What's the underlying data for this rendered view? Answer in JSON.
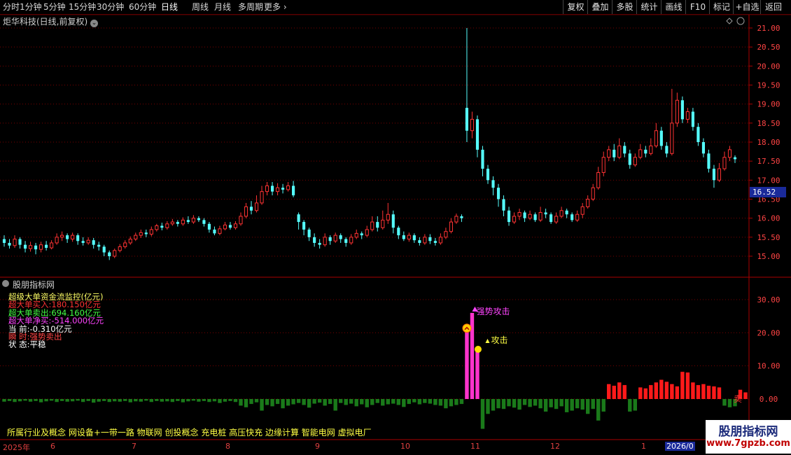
{
  "toolbar": {
    "periods": [
      "分时",
      "1分钟",
      "5分钟",
      "15分钟",
      "30分钟",
      "60分钟",
      "日线",
      "周线",
      "月线",
      "多周期",
      "更多"
    ],
    "active_period": "日线",
    "right_buttons": [
      "复权",
      "叠加",
      "多股",
      "统计",
      "画线",
      "F10",
      "标记",
      "+自选",
      "返回"
    ]
  },
  "stock_title": "炬华科技(日线,前复权)",
  "price_axis": {
    "labels": [
      "21.00",
      "20.50",
      "20.00",
      "19.50",
      "19.00",
      "18.50",
      "18.00",
      "17.50",
      "17.00",
      "16.50",
      "16.00",
      "15.50",
      "15.00"
    ],
    "current_price": "16.52"
  },
  "indicator": {
    "panel_title": "股朋指标网",
    "lines": [
      {
        "text": "超级大单资金流监控(亿元)",
        "color": "#ffff66"
      },
      {
        "text": "超大单买入:180.150亿元",
        "color": "#ff3333"
      },
      {
        "text": "超大单卖出:694.160亿元",
        "color": "#44ff44"
      },
      {
        "text": "超大单净买:-514.000亿元",
        "color": "#ff44ff"
      },
      {
        "text": "当      前:-0.310亿元",
        "color": "#ffffff"
      },
      {
        "text": "瞬      时:强势卖出",
        "color": "#ff4444"
      },
      {
        "text": "状      态:平稳",
        "color": "#ffffff"
      }
    ],
    "axis_labels": [
      "30.00",
      "20.00",
      "10.00",
      "0.00"
    ],
    "annotation_strong": "强势攻击",
    "annotation_attack": "攻击",
    "annotation_end": "卖"
  },
  "concepts": "所属行业及概念  网设备+一带一路 物联网 创投概念 充电桩 高压快充 边缘计算 智能电网 虚拟电厂",
  "date_axis": [
    "2025年",
    "6",
    "7",
    "8",
    "9",
    "10",
    "11",
    "12",
    "1",
    "2026/0"
  ],
  "watermark": {
    "line1": "股朋指标网",
    "line2": "www.7gpzb.com"
  },
  "colors": {
    "up": "#ff3333",
    "down": "#55ffff",
    "grid": "#7a0000",
    "inflow": "#ff1a1a",
    "outflow": "#1a7a1a",
    "signal": "#ff33cc"
  },
  "chart_data": {
    "type": "candlestick",
    "ylim": [
      14.7,
      21.2
    ],
    "candles": [
      [
        15.45,
        15.35,
        15.55,
        15.25
      ],
      [
        15.35,
        15.28,
        15.45,
        15.2
      ],
      [
        15.28,
        15.45,
        15.55,
        15.22
      ],
      [
        15.45,
        15.3,
        15.5,
        15.2
      ],
      [
        15.3,
        15.2,
        15.4,
        15.1
      ],
      [
        15.2,
        15.28,
        15.38,
        15.12
      ],
      [
        15.28,
        15.18,
        15.35,
        15.05
      ],
      [
        15.18,
        15.3,
        15.38,
        15.1
      ],
      [
        15.3,
        15.22,
        15.4,
        15.15
      ],
      [
        15.22,
        15.35,
        15.42,
        15.18
      ],
      [
        15.35,
        15.5,
        15.6,
        15.3
      ],
      [
        15.5,
        15.55,
        15.65,
        15.4
      ],
      [
        15.55,
        15.45,
        15.6,
        15.35
      ],
      [
        15.45,
        15.55,
        15.62,
        15.38
      ],
      [
        15.55,
        15.4,
        15.6,
        15.3
      ],
      [
        15.4,
        15.35,
        15.5,
        15.28
      ],
      [
        15.35,
        15.42,
        15.5,
        15.3
      ],
      [
        15.42,
        15.3,
        15.48,
        15.2
      ],
      [
        15.3,
        15.25,
        15.38,
        15.15
      ],
      [
        15.25,
        15.1,
        15.3,
        15.0
      ],
      [
        15.1,
        15.0,
        15.15,
        14.9
      ],
      [
        15.0,
        15.15,
        15.2,
        14.95
      ],
      [
        15.15,
        15.25,
        15.32,
        15.1
      ],
      [
        15.25,
        15.35,
        15.42,
        15.2
      ],
      [
        15.35,
        15.45,
        15.52,
        15.3
      ],
      [
        15.45,
        15.55,
        15.62,
        15.4
      ],
      [
        15.55,
        15.62,
        15.7,
        15.48
      ],
      [
        15.62,
        15.58,
        15.7,
        15.5
      ],
      [
        15.58,
        15.7,
        15.78,
        15.52
      ],
      [
        15.7,
        15.8,
        15.85,
        15.65
      ],
      [
        15.8,
        15.75,
        15.88,
        15.68
      ],
      [
        15.75,
        15.85,
        15.92,
        15.7
      ],
      [
        15.85,
        15.9,
        15.98,
        15.8
      ],
      [
        15.9,
        15.85,
        15.95,
        15.78
      ],
      [
        15.85,
        15.95,
        16.02,
        15.8
      ],
      [
        15.95,
        15.9,
        16.05,
        15.85
      ],
      [
        15.9,
        16.0,
        16.08,
        15.85
      ],
      [
        16.0,
        15.95,
        16.05,
        15.9
      ],
      [
        15.95,
        15.85,
        16.0,
        15.78
      ],
      [
        15.85,
        15.7,
        15.9,
        15.62
      ],
      [
        15.7,
        15.6,
        15.78,
        15.55
      ],
      [
        15.6,
        15.72,
        15.8,
        15.55
      ],
      [
        15.72,
        15.82,
        15.9,
        15.68
      ],
      [
        15.82,
        15.75,
        15.9,
        15.7
      ],
      [
        15.75,
        15.85,
        15.92,
        15.7
      ],
      [
        15.85,
        16.05,
        16.15,
        15.8
      ],
      [
        16.05,
        16.3,
        16.4,
        16.0
      ],
      [
        16.3,
        16.2,
        16.45,
        16.1
      ],
      [
        16.2,
        16.4,
        16.6,
        16.15
      ],
      [
        16.4,
        16.7,
        16.85,
        16.35
      ],
      [
        16.7,
        16.85,
        16.95,
        16.6
      ],
      [
        16.85,
        16.7,
        16.95,
        16.6
      ],
      [
        16.7,
        16.8,
        16.92,
        16.6
      ],
      [
        16.8,
        16.75,
        16.9,
        16.65
      ],
      [
        16.75,
        16.85,
        16.95,
        16.7
      ],
      [
        16.85,
        16.6,
        16.98,
        16.55
      ],
      [
        16.1,
        15.9,
        16.15,
        15.7
      ],
      [
        15.9,
        15.7,
        15.95,
        15.55
      ],
      [
        15.7,
        15.5,
        15.75,
        15.4
      ],
      [
        15.5,
        15.35,
        15.6,
        15.25
      ],
      [
        15.35,
        15.3,
        15.45,
        15.2
      ],
      [
        15.3,
        15.5,
        15.6,
        15.25
      ],
      [
        15.5,
        15.4,
        15.55,
        15.3
      ],
      [
        15.4,
        15.55,
        15.62,
        15.35
      ],
      [
        15.55,
        15.45,
        15.6,
        15.35
      ],
      [
        15.45,
        15.35,
        15.5,
        15.25
      ],
      [
        15.35,
        15.5,
        15.58,
        15.3
      ],
      [
        15.5,
        15.6,
        15.7,
        15.45
      ],
      [
        15.6,
        15.55,
        15.65,
        15.45
      ],
      [
        15.55,
        15.7,
        15.8,
        15.5
      ],
      [
        15.7,
        15.9,
        16.05,
        15.65
      ],
      [
        15.9,
        15.75,
        16.05,
        15.65
      ],
      [
        15.75,
        15.95,
        16.2,
        15.7
      ],
      [
        15.95,
        16.1,
        16.4,
        15.85
      ],
      [
        16.1,
        15.75,
        16.2,
        15.6
      ],
      [
        15.75,
        15.55,
        15.8,
        15.45
      ],
      [
        15.55,
        15.45,
        15.65,
        15.4
      ],
      [
        15.45,
        15.55,
        15.62,
        15.38
      ],
      [
        15.55,
        15.42,
        15.6,
        15.35
      ],
      [
        15.42,
        15.35,
        15.5,
        15.28
      ],
      [
        15.35,
        15.5,
        15.58,
        15.3
      ],
      [
        15.5,
        15.4,
        15.58,
        15.32
      ],
      [
        15.4,
        15.35,
        15.48,
        15.28
      ],
      [
        15.35,
        15.5,
        15.6,
        15.3
      ],
      [
        15.5,
        15.65,
        15.75,
        15.45
      ],
      [
        15.65,
        15.9,
        16.0,
        15.6
      ],
      [
        15.9,
        16.05,
        16.12,
        15.85
      ],
      [
        16.05,
        16.0,
        16.1,
        15.9
      ],
      [
        18.9,
        18.3,
        21.0,
        18.0
      ],
      [
        18.3,
        18.6,
        18.8,
        18.1
      ],
      [
        18.6,
        17.8,
        18.7,
        17.6
      ],
      [
        17.8,
        17.3,
        17.9,
        17.1
      ],
      [
        17.3,
        17.0,
        17.4,
        16.9
      ],
      [
        17.0,
        16.8,
        17.1,
        16.6
      ],
      [
        16.8,
        16.5,
        16.9,
        16.3
      ],
      [
        16.5,
        16.2,
        16.6,
        16.05
      ],
      [
        16.2,
        15.9,
        16.3,
        15.8
      ],
      [
        15.9,
        16.05,
        16.15,
        15.85
      ],
      [
        16.05,
        16.15,
        16.25,
        15.95
      ],
      [
        16.15,
        16.0,
        16.2,
        15.9
      ],
      [
        16.0,
        16.1,
        16.2,
        15.95
      ],
      [
        16.1,
        15.95,
        16.15,
        15.9
      ],
      [
        15.95,
        16.15,
        16.3,
        15.9
      ],
      [
        16.15,
        16.1,
        16.25,
        16.0
      ],
      [
        16.1,
        15.9,
        16.15,
        15.85
      ],
      [
        15.9,
        16.05,
        16.15,
        15.85
      ],
      [
        16.05,
        16.2,
        16.3,
        16.0
      ],
      [
        16.2,
        16.1,
        16.25,
        16.0
      ],
      [
        16.1,
        15.95,
        16.15,
        15.9
      ],
      [
        15.95,
        16.1,
        16.2,
        15.9
      ],
      [
        16.1,
        16.3,
        16.4,
        16.0
      ],
      [
        16.3,
        16.5,
        16.6,
        16.25
      ],
      [
        16.5,
        16.8,
        16.9,
        16.45
      ],
      [
        16.8,
        17.2,
        17.35,
        16.75
      ],
      [
        17.2,
        17.6,
        17.75,
        17.1
      ],
      [
        17.6,
        17.8,
        17.9,
        17.5
      ],
      [
        17.8,
        17.6,
        17.95,
        17.5
      ],
      [
        17.6,
        17.9,
        18.1,
        17.55
      ],
      [
        17.9,
        17.7,
        18.0,
        17.6
      ],
      [
        17.7,
        17.4,
        17.8,
        17.3
      ],
      [
        17.4,
        17.6,
        17.7,
        17.35
      ],
      [
        17.6,
        17.8,
        17.95,
        17.55
      ],
      [
        17.8,
        17.7,
        17.9,
        17.6
      ],
      [
        17.7,
        17.9,
        18.1,
        17.65
      ],
      [
        17.9,
        18.3,
        18.5,
        17.85
      ],
      [
        18.3,
        17.9,
        18.4,
        17.8
      ],
      [
        17.9,
        17.7,
        18.0,
        17.6
      ],
      [
        17.7,
        18.5,
        19.4,
        17.65
      ],
      [
        18.5,
        19.1,
        19.3,
        18.4
      ],
      [
        19.1,
        18.6,
        19.2,
        18.5
      ],
      [
        18.6,
        18.8,
        18.9,
        18.5
      ],
      [
        18.8,
        18.4,
        18.9,
        18.3
      ],
      [
        18.4,
        18.0,
        18.5,
        17.9
      ],
      [
        18.0,
        17.7,
        18.1,
        17.6
      ],
      [
        17.7,
        17.3,
        17.8,
        17.2
      ],
      [
        17.3,
        17.0,
        17.4,
        16.8
      ],
      [
        17.0,
        17.3,
        17.45,
        16.95
      ],
      [
        17.3,
        17.6,
        17.75,
        17.25
      ],
      [
        17.6,
        17.8,
        17.9,
        17.5
      ],
      [
        17.6,
        17.55,
        17.65,
        17.45
      ]
    ],
    "flow": [
      -0.8,
      -0.6,
      -0.9,
      -0.7,
      -0.5,
      -0.8,
      -0.6,
      -1.0,
      -0.7,
      -0.5,
      -0.9,
      -0.6,
      -0.8,
      -0.7,
      -0.5,
      -0.9,
      -0.6,
      -1.1,
      -0.8,
      -0.6,
      -0.9,
      -0.7,
      -0.8,
      -0.6,
      -1.0,
      -0.7,
      -0.8,
      -0.5,
      -0.9,
      -0.6,
      -0.8,
      -0.7,
      -0.9,
      -0.6,
      -1.0,
      -0.7,
      -0.5,
      -0.8,
      -0.6,
      -0.9,
      -0.7,
      -1.2,
      -0.8,
      -0.6,
      -0.9,
      -2.0,
      -2.5,
      -1.5,
      -1.0,
      -3.5,
      -1.8,
      -2.2,
      -1.5,
      -2.8,
      -2.0,
      -1.6,
      -1.2,
      -1.8,
      -2.6,
      -1.4,
      -1.1,
      -2.0,
      -1.5,
      -3.5,
      -1.2,
      -1.8,
      -1.4,
      -2.2,
      -1.6,
      -2.5,
      -1.8,
      -1.2,
      -2.0,
      -1.6,
      -1.4,
      -1.8,
      -2.4,
      -1.5,
      -1.0,
      -1.6,
      -1.2,
      -1.4,
      -1.8,
      -2.0,
      -2.8,
      -2.2,
      -1.8,
      -1.5,
      22,
      26,
      15,
      -9,
      -4.5,
      -3.5,
      -2.8,
      -3.0,
      -2.2,
      -2.6,
      -3.2,
      -1.8,
      -2.4,
      -2.0,
      -2.8,
      -3.8,
      -2.5,
      -3.0,
      -2.2,
      -4.0,
      -3.5,
      -2.8,
      -3.2,
      -4.5,
      -3.0,
      -6.5,
      -3.8,
      4.5,
      4.0,
      5.0,
      4.2,
      -3.8,
      -3.5,
      3.5,
      3.2,
      4.2,
      5.0,
      5.8,
      5.2,
      4.5,
      3.8,
      8.2,
      8.0,
      5.0,
      4.2,
      4.5,
      4.0,
      3.8,
      3.5,
      -2.0,
      -2.5,
      -2.2,
      2.8,
      2.0
    ]
  }
}
